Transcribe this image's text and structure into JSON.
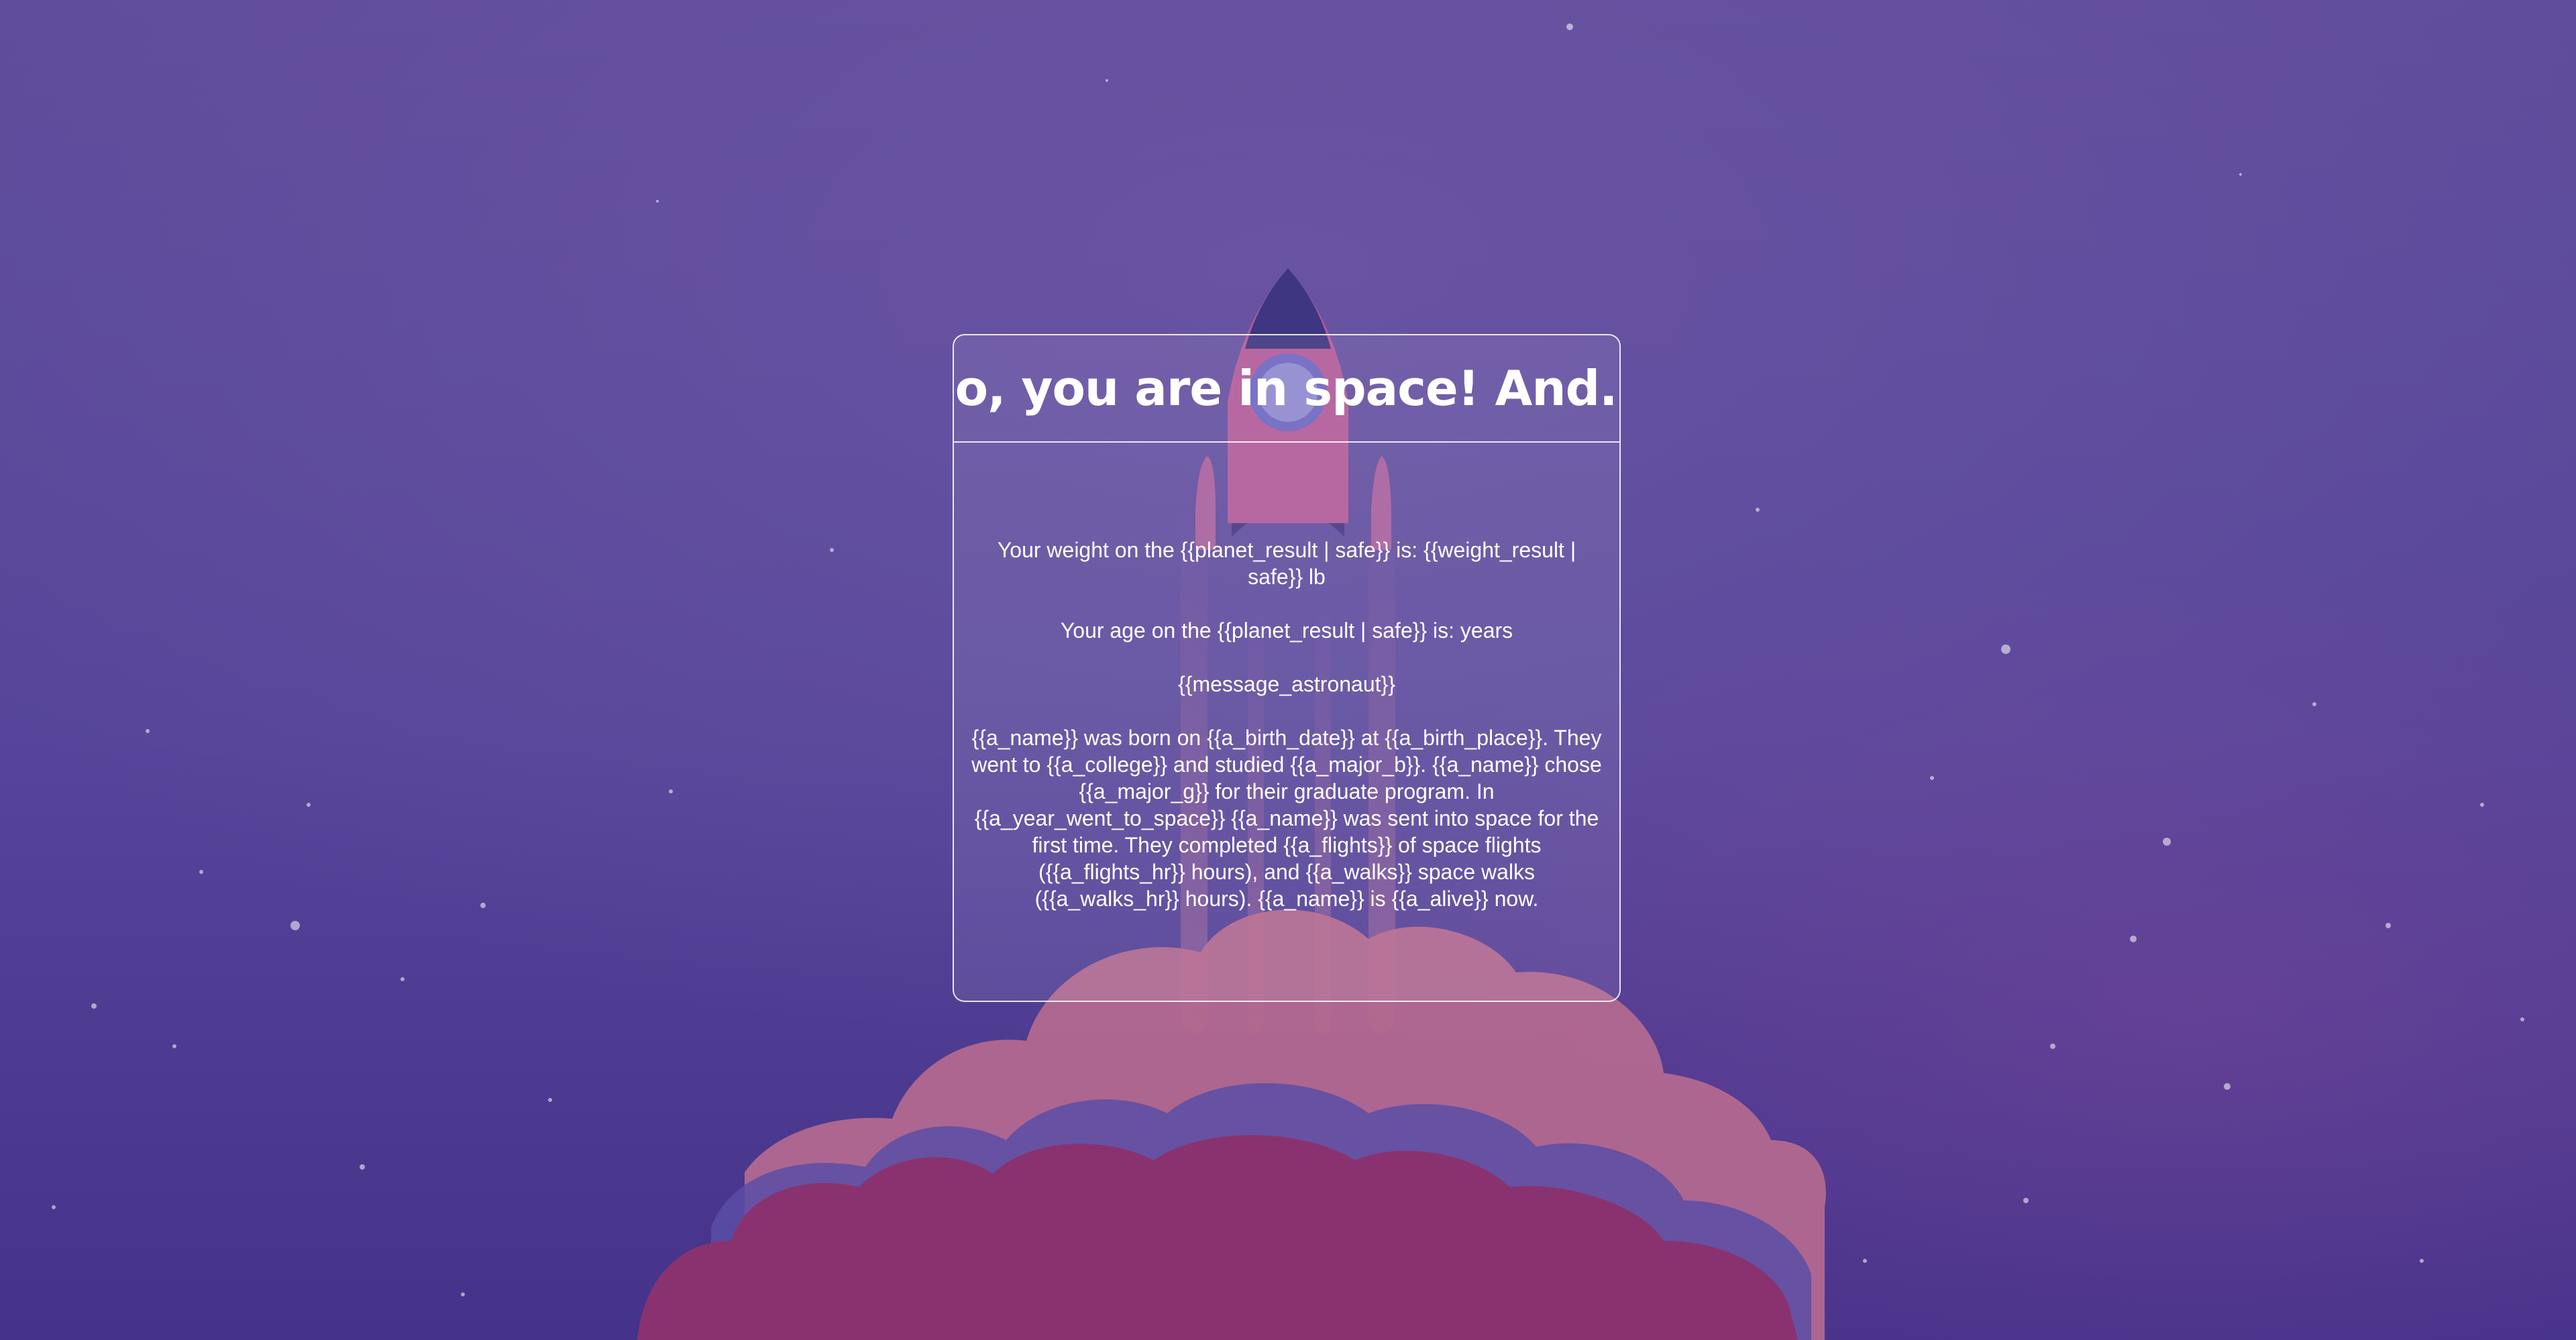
{
  "card": {
    "title": "So, you are in space! And...",
    "weight_line": "Your weight on the {{planet_result | safe}} is: {{weight_result | safe}} lb",
    "age_line": "Your age on the {{planet_result | safe}} is: years",
    "message_line": "{{message_astronaut}}",
    "bio_paragraph": "{{a_name}} was born on {{a_birth_date}} at {{a_birth_place}}. They went to {{a_college}} and studied {{a_major_b}}. {{a_name}} chose {{a_major_g}} for their graduate program. In {{a_year_went_to_space}} {{a_name}} was sent into space for the first time. They completed {{a_flights}} of space flights ({{a_flights_hr}} hours), and {{a_walks}} space walks ({{a_walks_hr}} hours). {{a_name}} is {{a_alive}} now."
  },
  "colors": {
    "background": "#5a4896",
    "rocket_body": "#b75d9b",
    "rocket_nose": "#3f3682",
    "window_ring": "#8079c9",
    "cloud_back": "#b56a8f",
    "cloud_front": "#8a3270",
    "text": "#ffffff"
  },
  "icons": {
    "background_illustration": "rocket-launch-illustration"
  }
}
